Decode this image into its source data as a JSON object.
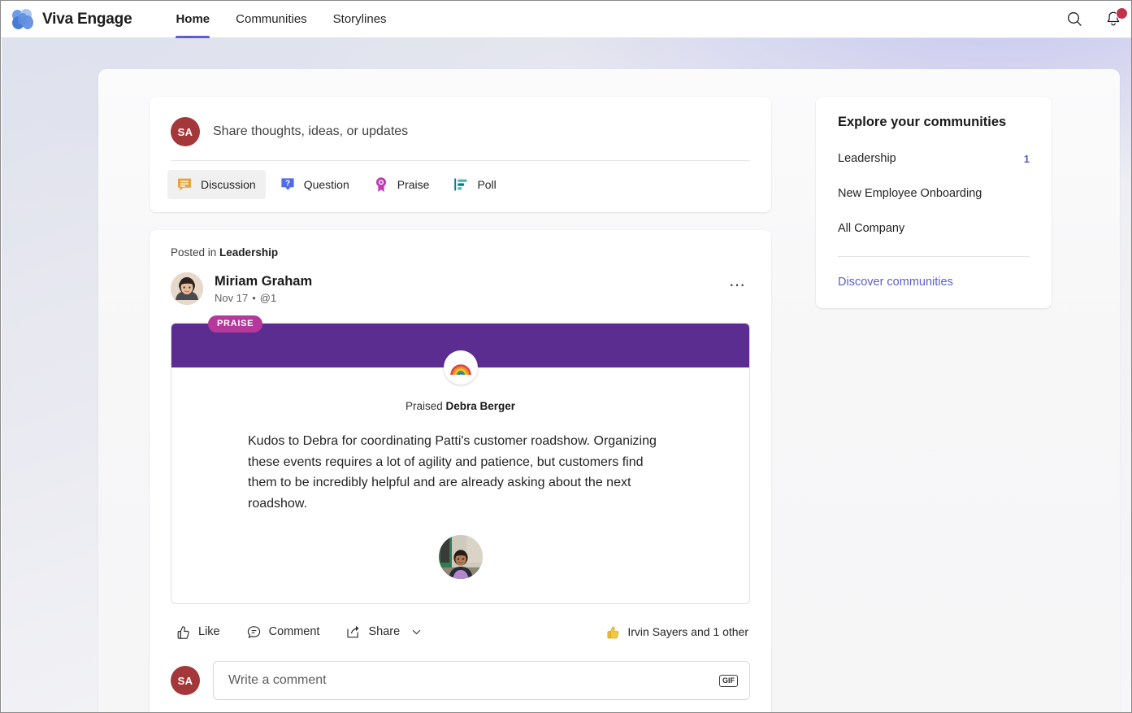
{
  "header": {
    "brand": "Viva Engage",
    "logo_icon": "viva-engage-logo",
    "nav": [
      {
        "label": "Home",
        "active": true
      },
      {
        "label": "Communities",
        "active": false
      },
      {
        "label": "Storylines",
        "active": false
      }
    ],
    "search_icon": "search-icon",
    "bell_icon": "notifications-bell-icon",
    "bell_badge": ""
  },
  "composer": {
    "avatar_initials": "SA",
    "avatar_color": "#a4373a",
    "placeholder": "Share thoughts, ideas, or updates",
    "types": [
      {
        "label": "Discussion",
        "icon": "discussion-icon",
        "color": "#e8a33d",
        "selected": true
      },
      {
        "label": "Question",
        "icon": "question-icon",
        "color": "#4f6bed",
        "selected": false
      },
      {
        "label": "Praise",
        "icon": "praise-icon",
        "color": "#c239b3",
        "selected": false
      },
      {
        "label": "Poll",
        "icon": "poll-icon",
        "color": "#038387",
        "selected": false
      }
    ]
  },
  "post": {
    "posted_in_prefix": "Posted in ",
    "community": "Leadership",
    "author": "Miriam Graham",
    "date": "Nov 17",
    "separator": "•",
    "mentions": "@1",
    "overflow_icon": "more-options-icon",
    "praise": {
      "badge": "PRAISE",
      "badge_color": "#b5399b",
      "banner_color": "#5c2d91",
      "emoji_icon": "rainbow-icon",
      "praised_prefix": "Praised ",
      "praised_person": "Debra Berger",
      "body": "Kudos to Debra for coordinating Patti's customer roadshow. Organizing these events requires a lot of agility and patience, but customers find them to be incredibly helpful and are already asking about the next roadshow.",
      "photo_alt": "debra-berger-photo"
    },
    "actions": [
      {
        "label": "Like",
        "icon": "like-thumb-icon"
      },
      {
        "label": "Comment",
        "icon": "comment-bubble-icon"
      },
      {
        "label": "Share",
        "icon": "share-icon",
        "chevron": true
      }
    ],
    "reactions": {
      "icon": "thumbs-up-reaction-icon",
      "text": "Irvin Sayers and 1 other"
    }
  },
  "comment": {
    "avatar_initials": "SA",
    "placeholder": "Write a comment",
    "gif_label": "GIF"
  },
  "rail": {
    "title": "Explore your communities",
    "items": [
      {
        "label": "Leadership",
        "count": "1"
      },
      {
        "label": "New Employee Onboarding",
        "count": ""
      },
      {
        "label": "All Company",
        "count": ""
      }
    ],
    "link": "Discover communities",
    "accent": "#5b5fc7"
  }
}
